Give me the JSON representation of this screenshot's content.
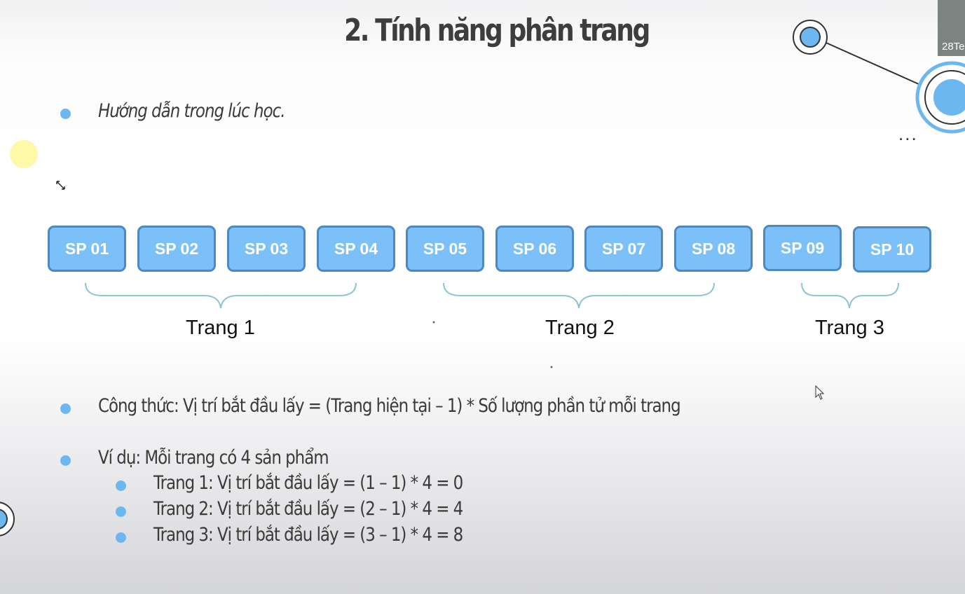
{
  "slide": {
    "title": "2. Tính năng phân trang",
    "intro": "Hướng dẫn trong lúc học.",
    "products": [
      "SP 01",
      "SP 02",
      "SP 03",
      "SP 04",
      "SP 05",
      "SP 06",
      "SP 07",
      "SP 08",
      "SP 09",
      "SP 10"
    ],
    "pages": [
      "Trang 1",
      "Trang 2",
      "Trang 3"
    ],
    "formula": "Công thức: Vị trí bắt đầu lấy = (Trang hiện tại – 1) * Số lượng phần tử mỗi trang",
    "example": "Ví dụ: Mỗi trang có 4 sản phẩm",
    "example_items": [
      "Trang 1: Vị trí bắt đầu lấy = (1 – 1) * 4 = 0",
      "Trang 2: Vị trí bắt đầu lấy = (2 – 1) * 4 = 4",
      "Trang 3: Vị trí bắt đầu lấy = (3 – 1) * 4 = 8"
    ]
  },
  "overlay": {
    "video_label": "28Te",
    "more_menu": "..."
  },
  "colors": {
    "accent": "#7bc0f8",
    "accent_border": "#4d88c0",
    "bullet": "#6db7f0",
    "brace": "#8cc4d8"
  }
}
